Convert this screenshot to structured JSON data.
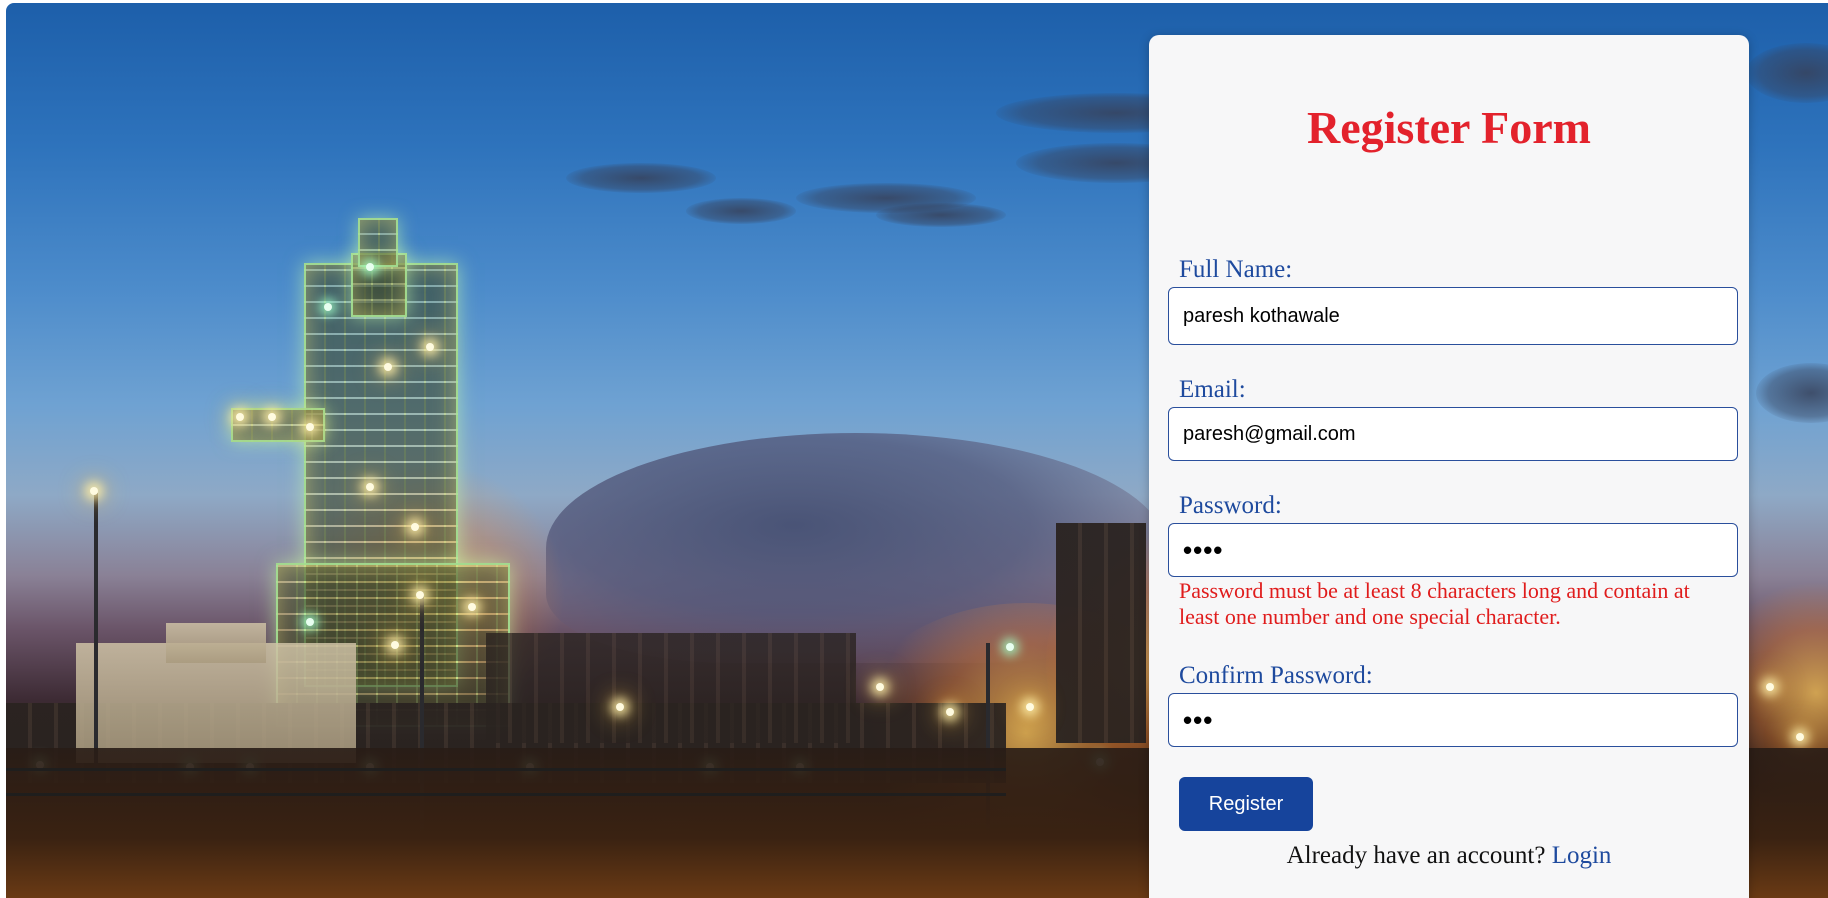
{
  "form": {
    "title": "Register Form",
    "fields": {
      "full_name": {
        "label": "Full Name:",
        "value": "paresh kothawale"
      },
      "email": {
        "label": "Email:",
        "value": "paresh@gmail.com"
      },
      "password": {
        "label": "Password:",
        "masked_value": "••••"
      },
      "confirm_password": {
        "label": "Confirm Password:",
        "masked_value": "•••"
      }
    },
    "password_error": "Password must be at least 8 characters long and contain at least one number and one special character.",
    "register_label": "Register",
    "login_prompt": "Already have an account?",
    "login_link": "Login"
  },
  "colors": {
    "title": "#e3222c",
    "label": "#1e4a9e",
    "error": "#e01c1c",
    "button": "#16449c",
    "card": "#f7f7f8"
  }
}
